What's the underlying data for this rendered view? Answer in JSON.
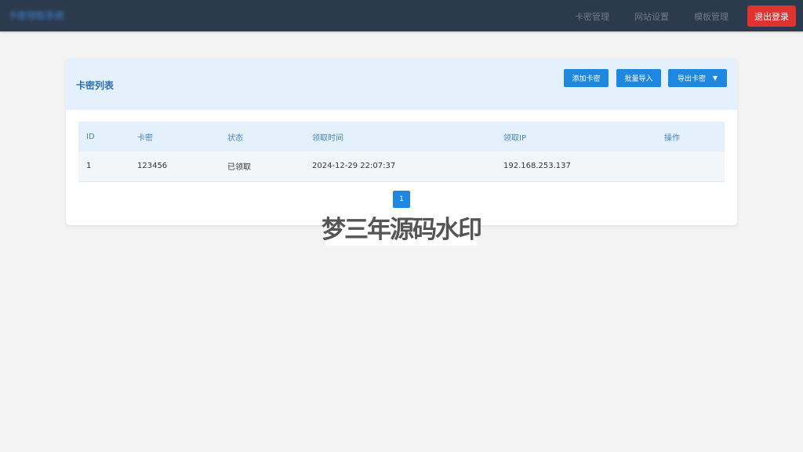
{
  "header": {
    "brand": "卡密领取系统",
    "nav": [
      "卡密管理",
      "网站设置",
      "模板管理"
    ],
    "logout_label": "退出登录"
  },
  "card": {
    "title": "卡密列表",
    "buttons": {
      "add": "添加卡密",
      "import": "批量导入",
      "export": "导出卡密"
    }
  },
  "table": {
    "columns": [
      "ID",
      "卡密",
      "状态",
      "领取时间",
      "领取IP",
      "操作"
    ],
    "rows": [
      [
        "1",
        "123456",
        "已领取",
        "2024-12-29 22:07:37",
        "192.168.253.137",
        ""
      ]
    ]
  },
  "pagination": {
    "current_page": "1"
  },
  "watermark": "梦三年源码水印"
}
